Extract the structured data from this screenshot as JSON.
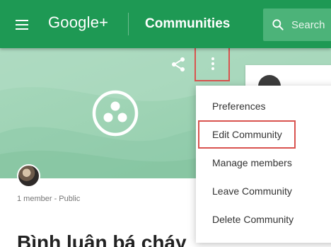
{
  "header": {
    "brand": "Google+",
    "title": "Communities",
    "search_placeholder": "Search"
  },
  "cover": {
    "background_color": "#a8d8bd",
    "accent_color": "#1e9954",
    "highlight_color": "#d9534f"
  },
  "community": {
    "meta": "1 member - Public",
    "name": "Bình luận bá cháy"
  },
  "menu": {
    "items": [
      {
        "label": "Preferences"
      },
      {
        "label": "Edit Community"
      },
      {
        "label": "Manage members"
      },
      {
        "label": "Leave Community"
      },
      {
        "label": "Delete Community"
      }
    ]
  },
  "icons": {
    "menu": "hamburger-menu-icon",
    "search": "search-icon",
    "share": "share-icon",
    "more": "more-vertical-icon",
    "community": "community-logo-icon"
  }
}
